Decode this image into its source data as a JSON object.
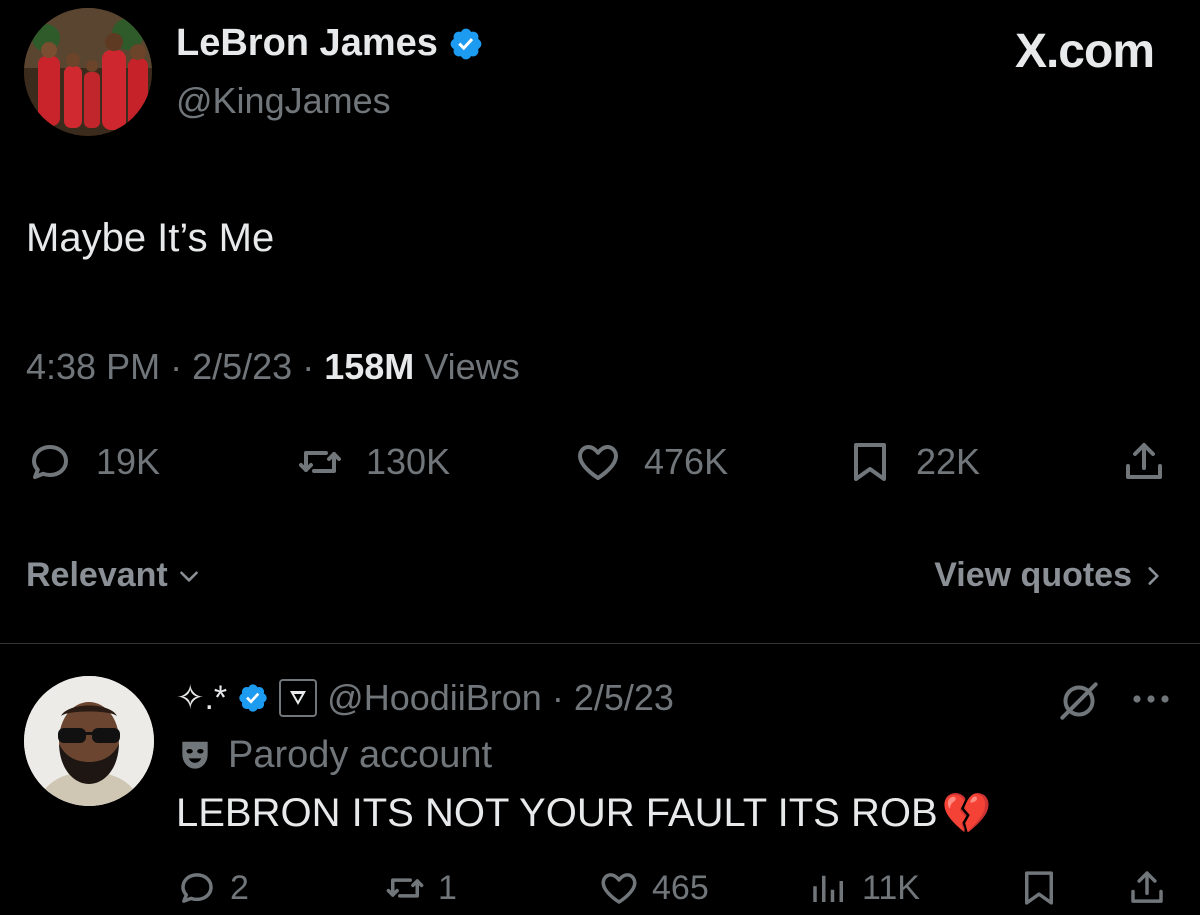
{
  "tweet": {
    "author_name": "LeBron James",
    "author_handle": "@KingJames",
    "text": "Maybe It’s Me",
    "time": "4:38 PM",
    "date": "2/5/23",
    "views_count": "158M",
    "views_label": "Views",
    "separator": "·"
  },
  "brand": {
    "label": "X.com"
  },
  "actions": {
    "replies": "19K",
    "retweets": "130K",
    "likes": "476K",
    "bookmarks": "22K"
  },
  "sort": {
    "relevant_label": "Relevant",
    "view_quotes_label": "View quotes"
  },
  "reply": {
    "display_name": "✧.*",
    "handle": "@HoodiiBron",
    "separator": "·",
    "date": "2/5/23",
    "account_label": "Parody account",
    "text": "LEBRON ITS NOT YOUR FAULT ITS ROB",
    "emoji": "💔",
    "actions": {
      "replies": "2",
      "retweets": "1",
      "likes": "465",
      "views": "11K"
    }
  },
  "colors": {
    "background": "#000000",
    "text_primary": "#e7e9ea",
    "text_secondary": "#71767b",
    "verified_blue": "#1d9bf0",
    "divider": "#2f3336"
  },
  "icons": {
    "verified": "verified-badge-icon",
    "reply": "reply-bubble-icon",
    "retweet": "retweet-icon",
    "like": "heart-icon",
    "bookmark": "bookmark-icon",
    "share": "share-icon",
    "chevron": "chevron-down-icon",
    "chevron_right": "chevron-right-icon",
    "grok": "grok-icon",
    "more": "more-icon",
    "views": "views-bar-icon",
    "parody": "parody-mask-icon"
  }
}
